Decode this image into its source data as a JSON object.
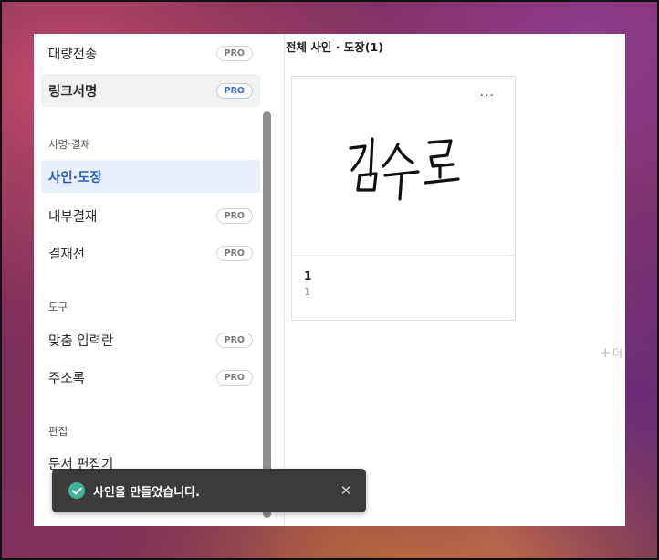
{
  "sidebar": {
    "top_items": [
      {
        "label": "대량전송",
        "badge": "PRO"
      },
      {
        "label": "링크서명",
        "badge": "PRO"
      }
    ],
    "sections": [
      {
        "title": "서명·결재",
        "items": [
          {
            "label": "사인·도장"
          },
          {
            "label": "내부결재",
            "badge": "PRO"
          },
          {
            "label": "결재선",
            "badge": "PRO"
          }
        ]
      },
      {
        "title": "도구",
        "items": [
          {
            "label": "맞춤 입력란",
            "badge": "PRO"
          },
          {
            "label": "주소록",
            "badge": "PRO"
          }
        ]
      },
      {
        "title": "편집",
        "items": [
          {
            "label": "문서 편집기"
          }
        ]
      }
    ]
  },
  "main": {
    "title": "전체 사인 · 도장(1)",
    "card": {
      "more": "···",
      "name": "1",
      "sub": "1"
    },
    "more_link": "더"
  },
  "toast": {
    "message": "사인을 만들었습니다.",
    "close": "✕"
  },
  "colors": {
    "accent": "#2d5fb8",
    "active_bg": "#e8f0fd",
    "toast_bg": "#3b3b3b",
    "success": "#3fb29a"
  }
}
